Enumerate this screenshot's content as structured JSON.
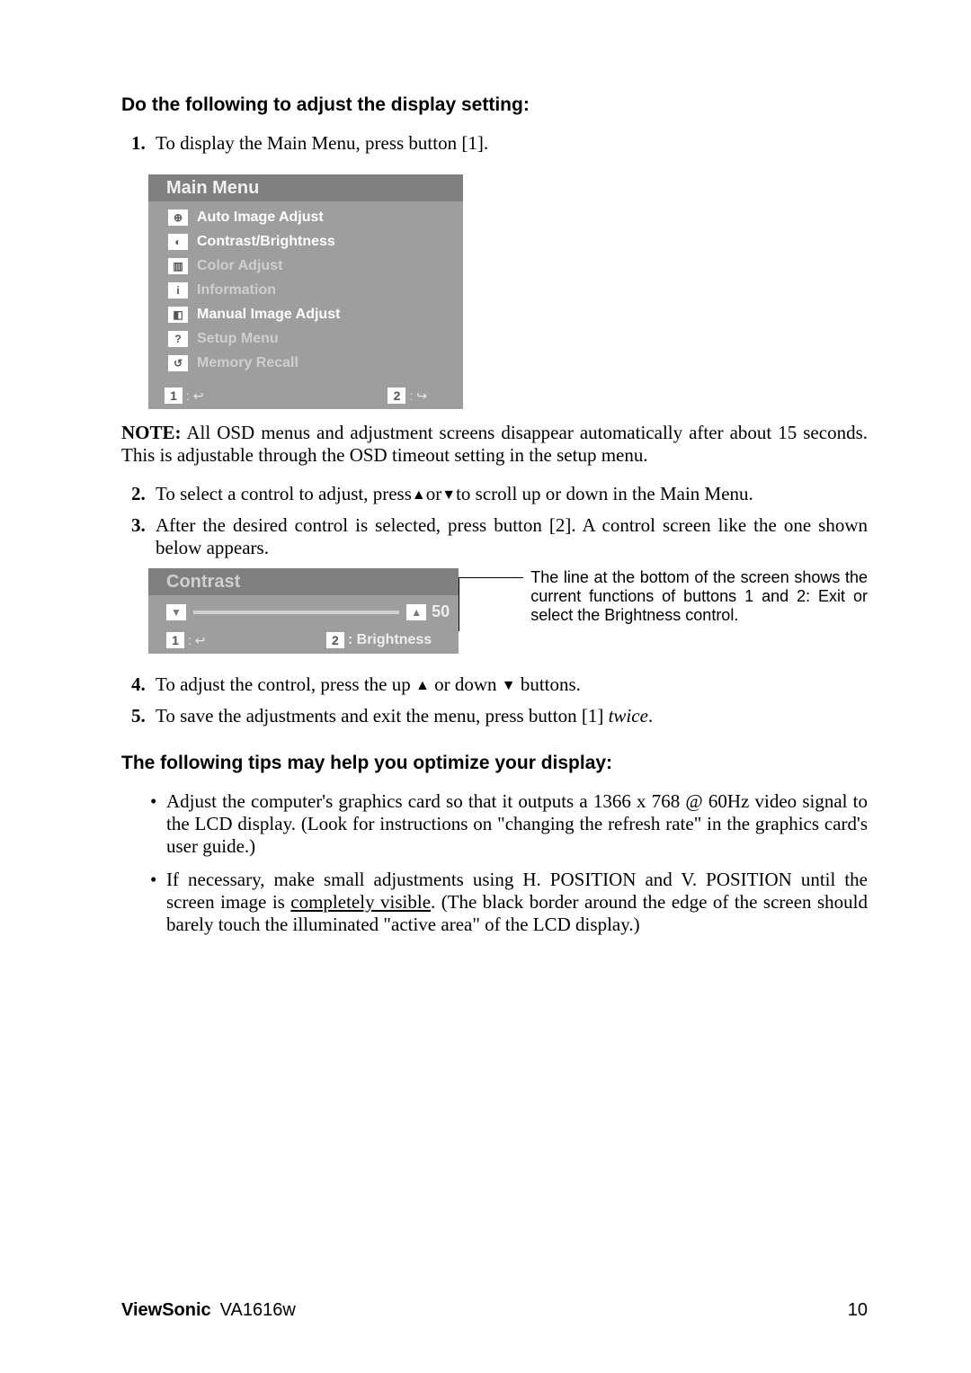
{
  "headings": {
    "adjust": "Do the following to adjust the display setting:",
    "tips": "The following tips may help you optimize your display:"
  },
  "step1": "To display the Main Menu, press button [1].",
  "note_label": "NOTE:",
  "note_text": " All OSD menus and adjustment screens disappear automatically after about 15 seconds. This is adjustable through the OSD timeout setting in the setup menu.",
  "step2_a": "To select a control to adjust, press",
  "step2_b": "or",
  "step2_c": "to scroll up or down in the Main Menu.",
  "step3": "After the desired control is selected, press button [2]. A control screen like the one shown below appears.",
  "step4_a": "To adjust the control, press the up ",
  "step4_b": " or down ",
  "step4_c": " buttons.",
  "step5_a": "To save the adjustments and exit the menu, press button [1] ",
  "step5_b": "twice",
  "step5_c": ".",
  "tip1": "Adjust the computer's graphics card so that it outputs a 1366 x 768 @ 60Hz video signal to the LCD display. (Look for instructions on \"changing the refresh rate\" in the graphics card's user guide.)",
  "tip2_a": "If necessary, make small adjustments using H. POSITION and V. POSITION until the screen image is ",
  "tip2_b": "completely visible",
  "tip2_c": ". (The black border around the edge of the screen should barely touch the illuminated \"active area\" of the LCD display.)",
  "osd_main": {
    "title": "Main Menu",
    "items": [
      {
        "label": "Auto Image Adjust",
        "icon": "⊕"
      },
      {
        "label": "Contrast/Brightness",
        "icon": "◐"
      },
      {
        "label": "Color Adjust",
        "icon": "▥"
      },
      {
        "label": "Information",
        "icon": "i"
      },
      {
        "label": "Manual Image Adjust",
        "icon": "◧"
      },
      {
        "label": "Setup Menu",
        "icon": "?"
      },
      {
        "label": "Memory Recall",
        "icon": "↺"
      }
    ],
    "key1": "1",
    "key2": "2"
  },
  "osd_contrast": {
    "title": "Contrast",
    "value": "50",
    "key1": "1",
    "key2_label": ": Brightness"
  },
  "callout": "The line at the bottom of the screen shows the current functions of buttons 1 and 2: Exit or select the Brightness control.",
  "footer": {
    "brand": "ViewSonic",
    "model": "VA1616w",
    "page": "10"
  }
}
